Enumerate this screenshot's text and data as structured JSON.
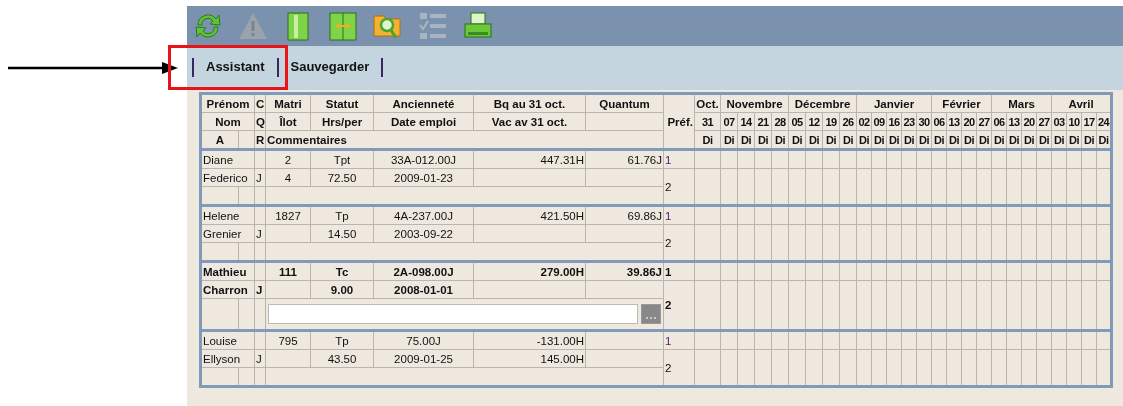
{
  "toolbar": [
    {
      "kind": "refresh",
      "disabled": false
    },
    {
      "kind": "warning",
      "disabled": true
    },
    {
      "kind": "panel",
      "disabled": false
    },
    {
      "kind": "split",
      "disabled": false
    },
    {
      "kind": "folder-search",
      "disabled": false
    },
    {
      "kind": "checklist",
      "disabled": true
    },
    {
      "kind": "printer",
      "disabled": false
    }
  ],
  "menu": [
    {
      "label": "Assistant",
      "highlighted": true
    },
    {
      "label": "Sauvegarder",
      "highlighted": false
    }
  ],
  "header": {
    "prenom": "Prénom",
    "nom": "Nom",
    "a": "A",
    "c": "C",
    "q": "Q",
    "r": "R",
    "matri": "Matri",
    "ilot": "Îlot",
    "statut": "Statut",
    "hrs": "Hrs/per",
    "anciennete": "Ancienneté",
    "date_emploi": "Date emploi",
    "bq": "Bq au 31 oct.",
    "vac": "Vac av 31 oct.",
    "quantum": "Quantum",
    "commentaires": "Commentaires",
    "pref": "Préf."
  },
  "months": [
    {
      "label": "Oct.",
      "weeks": [
        {
          "day": "31",
          "weekday": "Di"
        }
      ]
    },
    {
      "label": "Novembre",
      "weeks": [
        {
          "day": "07",
          "weekday": "Di"
        },
        {
          "day": "14",
          "weekday": "Di"
        },
        {
          "day": "21",
          "weekday": "Di"
        },
        {
          "day": "28",
          "weekday": "Di"
        }
      ]
    },
    {
      "label": "Décembre",
      "weeks": [
        {
          "day": "05",
          "weekday": "Di"
        },
        {
          "day": "12",
          "weekday": "Di"
        },
        {
          "day": "19",
          "weekday": "Di"
        },
        {
          "day": "26",
          "weekday": "Di"
        }
      ]
    },
    {
      "label": "Janvier",
      "weeks": [
        {
          "day": "02",
          "weekday": "Di"
        },
        {
          "day": "09",
          "weekday": "Di"
        },
        {
          "day": "16",
          "weekday": "Di"
        },
        {
          "day": "23",
          "weekday": "Di"
        },
        {
          "day": "30",
          "weekday": "Di"
        }
      ]
    },
    {
      "label": "Février",
      "weeks": [
        {
          "day": "06",
          "weekday": "Di"
        },
        {
          "day": "13",
          "weekday": "Di"
        },
        {
          "day": "20",
          "weekday": "Di"
        },
        {
          "day": "27",
          "weekday": "Di"
        }
      ]
    },
    {
      "label": "Mars",
      "weeks": [
        {
          "day": "06",
          "weekday": "Di"
        },
        {
          "day": "13",
          "weekday": "Di"
        },
        {
          "day": "20",
          "weekday": "Di"
        },
        {
          "day": "27",
          "weekday": "Di"
        }
      ]
    },
    {
      "label": "Avril",
      "weeks": [
        {
          "day": "03",
          "weekday": "Di"
        },
        {
          "day": "10",
          "weekday": "Di"
        },
        {
          "day": "17",
          "weekday": "Di"
        },
        {
          "day": "24",
          "weekday": "Di"
        }
      ]
    }
  ],
  "employees": [
    {
      "first": "Diane",
      "last": "Federico",
      "cq": "J",
      "matri": "2",
      "ilot": "4",
      "statut": "Tpt",
      "hrs": "72.50",
      "anciennete": "33A-012.00J",
      "date_emploi": "2009-01-23",
      "bq": "447.31H",
      "quantum": "61.76J",
      "pref": [
        "1",
        "2"
      ],
      "selected": false,
      "editing": false
    },
    {
      "first": "Helene",
      "last": "Grenier",
      "cq": "J",
      "matri": "1827",
      "statut": "Tp",
      "hrs": "14.50",
      "anciennete": "4A-237.00J",
      "date_emploi": "2003-09-22",
      "bq": "421.50H",
      "quantum": "69.86J",
      "pref": [
        "1",
        "2"
      ],
      "selected": false,
      "editing": false
    },
    {
      "first": "Mathieu",
      "last": "Charron",
      "cq": "J",
      "matri": "111",
      "statut": "Tc",
      "hrs": "9.00",
      "anciennete": "2A-098.00J",
      "date_emploi": "2008-01-01",
      "bq": "279.00H",
      "quantum": "39.86J",
      "pref": [
        "1",
        "2"
      ],
      "selected": true,
      "editing": true
    },
    {
      "first": "Louise",
      "last": "Ellyson",
      "cq": "J",
      "matri": "795",
      "statut": "Tp",
      "hrs": "43.50",
      "anciennete": "75.00J",
      "date_emploi": "2009-01-25",
      "bq": "-131.00H",
      "vac": "145.00H",
      "pref": [
        "1",
        "2"
      ],
      "selected": false,
      "editing": false
    }
  ]
}
